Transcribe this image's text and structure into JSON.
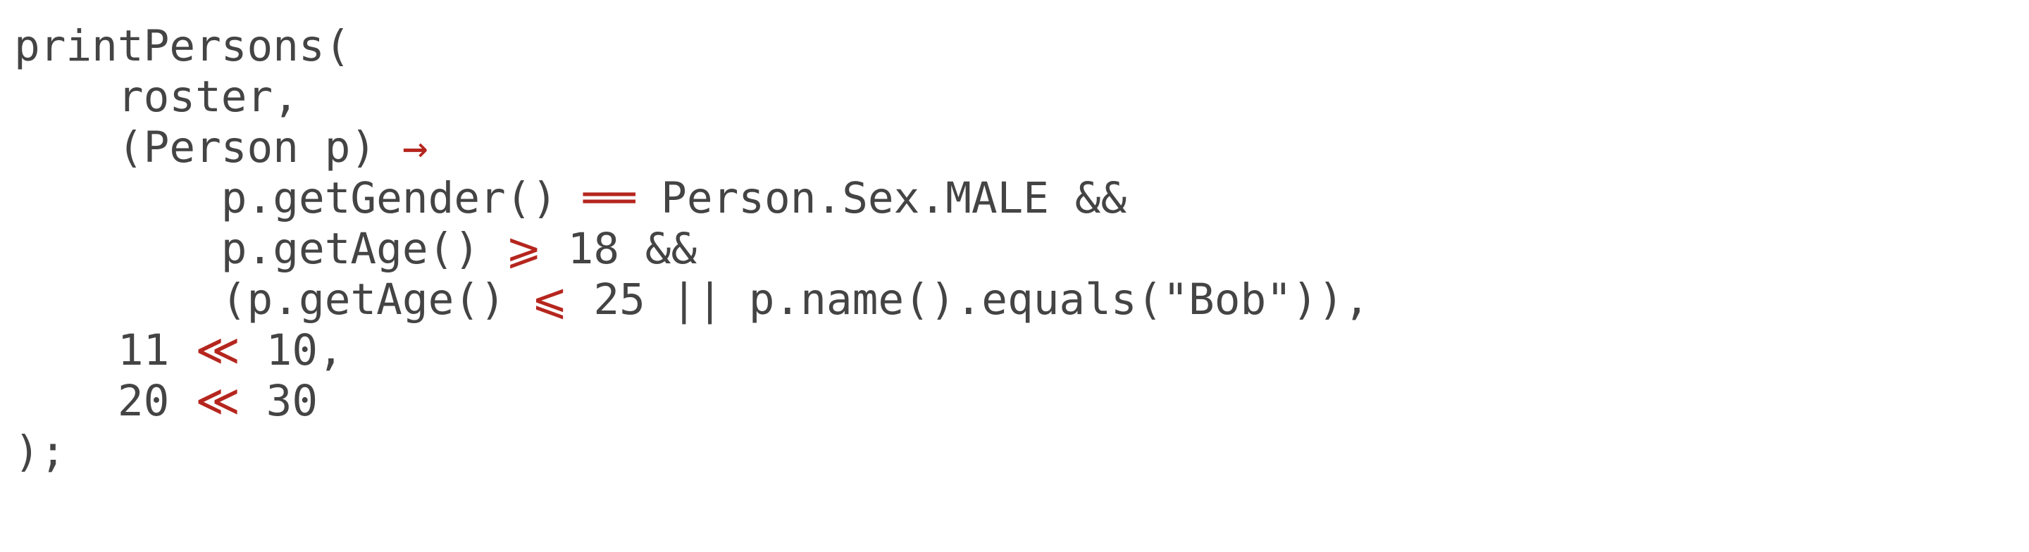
{
  "code": {
    "lines": [
      [
        {
          "t": "printPersons(",
          "k": "text"
        }
      ],
      [
        {
          "t": "    roster,",
          "k": "text"
        }
      ],
      [
        {
          "t": "    (Person p) ",
          "k": "text"
        },
        {
          "t": "→",
          "k": "op"
        }
      ],
      [
        {
          "t": "        p.getGender() ",
          "k": "text"
        },
        {
          "t": "══",
          "k": "op"
        },
        {
          "t": " Person.Sex.MALE &&",
          "k": "text"
        }
      ],
      [
        {
          "t": "        p.getAge() ",
          "k": "text"
        },
        {
          "t": "⩾",
          "k": "op"
        },
        {
          "t": " 18 &&",
          "k": "text"
        }
      ],
      [
        {
          "t": "        (p.getAge() ",
          "k": "text"
        },
        {
          "t": "⩽",
          "k": "op"
        },
        {
          "t": " 25 || p.name().equals(\"Bob\")),",
          "k": "text"
        }
      ],
      [
        {
          "t": "    11 ",
          "k": "text"
        },
        {
          "t": "≪",
          "k": "op"
        },
        {
          "t": " 10,",
          "k": "text"
        }
      ],
      [
        {
          "t": "    20 ",
          "k": "text"
        },
        {
          "t": "≪",
          "k": "op"
        },
        {
          "t": " 30",
          "k": "text"
        }
      ],
      [
        {
          "t": ");",
          "k": "text"
        }
      ]
    ]
  },
  "colors": {
    "text": "#444444",
    "operator": "#b5261e",
    "background": "#ffffff"
  }
}
